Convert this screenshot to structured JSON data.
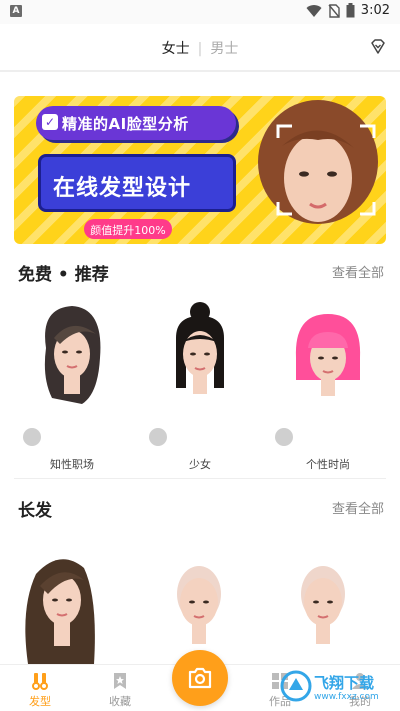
{
  "status_bar": {
    "time": "3:02",
    "notification_letter": "A"
  },
  "header": {
    "tabs": [
      {
        "label": "女士",
        "active": true
      },
      {
        "label": "男士",
        "active": false
      }
    ],
    "separator": "|"
  },
  "banner": {
    "tag": "精准的AI脸型分析",
    "title": "在线发型设计",
    "pill": "颜值提升100%"
  },
  "sections": [
    {
      "title": "免费 • 推荐",
      "more": "查看全部",
      "items": [
        {
          "label": "知性职场",
          "hair_color": "#3a3130"
        },
        {
          "label": "少女",
          "hair_color": "#1a1614"
        },
        {
          "label": "个性时尚",
          "hair_color": "#ff4f9a"
        }
      ]
    },
    {
      "title": "长发",
      "more": "查看全部",
      "items": [
        {
          "label": "",
          "hair_color": "#4a3526"
        },
        {
          "label": "",
          "hair_color": "#e9c9bd"
        },
        {
          "label": "",
          "hair_color": "#e9c9bd"
        }
      ]
    }
  ],
  "tabbar": {
    "items": [
      {
        "label": "发型",
        "active": true,
        "icon": "scissors-icon"
      },
      {
        "label": "收藏",
        "active": false,
        "icon": "bookmark-icon"
      },
      {
        "label": "作品",
        "active": false,
        "icon": "grid-icon"
      },
      {
        "label": "我的",
        "active": false,
        "icon": "person-icon"
      }
    ]
  },
  "watermark": {
    "text": "飞翔下载",
    "sub": "www.fxxz.com"
  },
  "colors": {
    "accent": "#ff9f1a",
    "banner_bg": "#ffd31a",
    "banner_purple": "#6a36d6",
    "banner_blue": "#3b3fd8",
    "pill_pink": "#ff3b8a"
  }
}
